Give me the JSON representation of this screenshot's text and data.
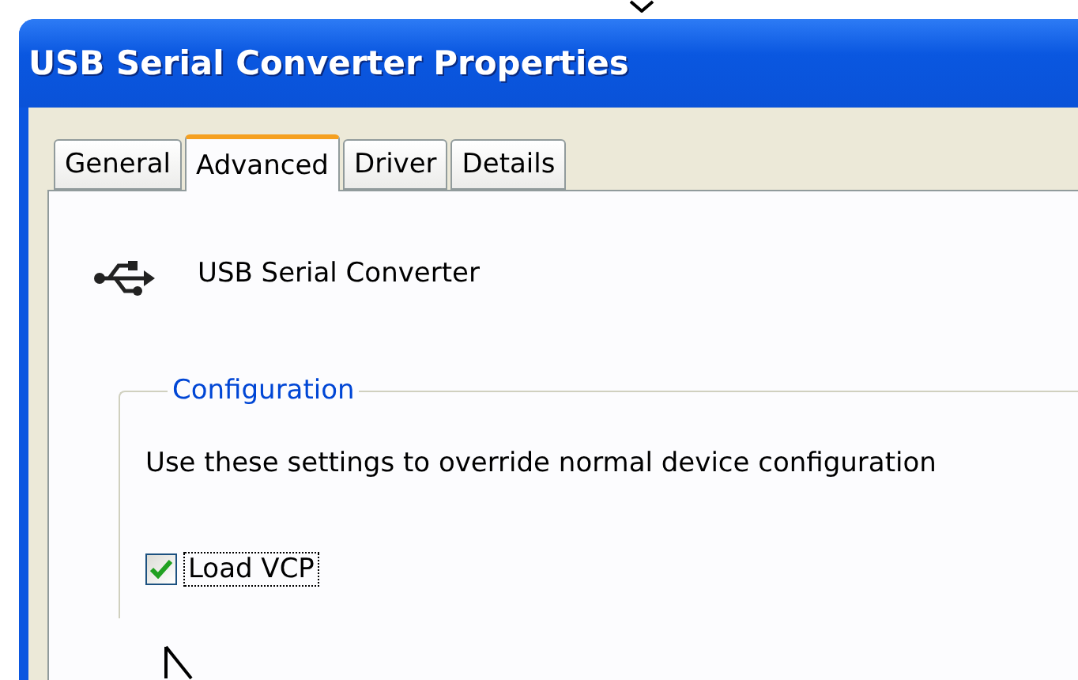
{
  "window": {
    "title": "USB Serial Converter Properties"
  },
  "tabs": [
    {
      "label": "General",
      "selected": false
    },
    {
      "label": "Advanced",
      "selected": true
    },
    {
      "label": "Driver",
      "selected": false
    },
    {
      "label": "Details",
      "selected": false
    }
  ],
  "device": {
    "name": "USB Serial Converter"
  },
  "group": {
    "title": "Configuration",
    "description": "Use these settings to override normal device configuration",
    "checkbox": {
      "label": "Load VCP",
      "checked": true
    }
  }
}
